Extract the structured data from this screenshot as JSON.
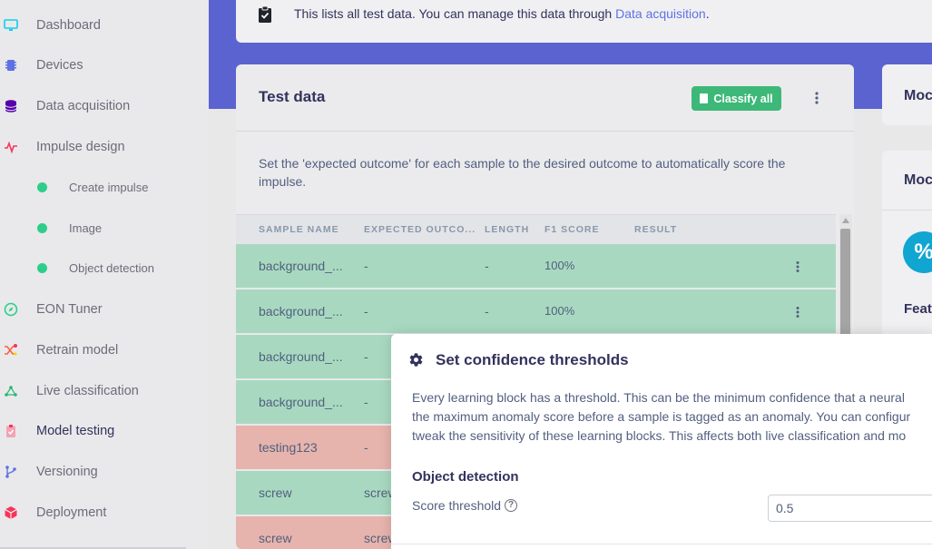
{
  "sidebar": {
    "items": [
      {
        "label": "Dashboard",
        "icon": "monitor-icon"
      },
      {
        "label": "Devices",
        "icon": "chip-icon"
      },
      {
        "label": "Data acquisition",
        "icon": "database-icon"
      },
      {
        "label": "Impulse design",
        "icon": "pulse-icon"
      },
      {
        "label": "Create impulse",
        "icon": "dot-icon"
      },
      {
        "label": "Image",
        "icon": "dot-icon"
      },
      {
        "label": "Object detection",
        "icon": "dot-icon"
      },
      {
        "label": "EON Tuner",
        "icon": "compass-icon"
      },
      {
        "label": "Retrain model",
        "icon": "shuffle-icon"
      },
      {
        "label": "Live classification",
        "icon": "network-icon"
      },
      {
        "label": "Model testing",
        "icon": "clipboard-check-icon"
      },
      {
        "label": "Versioning",
        "icon": "branch-icon"
      },
      {
        "label": "Deployment",
        "icon": "cube-icon"
      }
    ]
  },
  "info": {
    "text": "This lists all test data. You can manage this data through ",
    "link": "Data acquisition",
    "suffix": "."
  },
  "test_data": {
    "title": "Test data",
    "classify_all": "Classify all",
    "description": "Set the 'expected outcome' for each sample to the desired outcome to automatically score the impulse.",
    "columns": [
      "SAMPLE NAME",
      "EXPECTED OUTCO...",
      "LENGTH",
      "F1 SCORE",
      "RESULT"
    ],
    "rows": [
      {
        "name": "background_...",
        "expected": "-",
        "length": "-",
        "f1": "100%",
        "status": "pass"
      },
      {
        "name": "background_...",
        "expected": "-",
        "length": "-",
        "f1": "100%",
        "status": "pass"
      },
      {
        "name": "background_...",
        "expected": "-",
        "length": "",
        "f1": "",
        "status": "pass"
      },
      {
        "name": "background_...",
        "expected": "-",
        "length": "",
        "f1": "",
        "status": "pass"
      },
      {
        "name": "testing123",
        "expected": "-",
        "length": "",
        "f1": "",
        "status": "fail"
      },
      {
        "name": "screw",
        "expected": "screw",
        "length": "",
        "f1": "",
        "status": "pass"
      },
      {
        "name": "screw",
        "expected": "screw",
        "length": "",
        "f1": "",
        "status": "fail"
      }
    ]
  },
  "right_cards": {
    "card1_title": "Moc",
    "card2_title": "Moc",
    "card2_feat": "Feat",
    "card2_icon": "%"
  },
  "modal": {
    "title": "Set confidence thresholds",
    "desc_line1": "Every learning block has a threshold. This can be the minimum confidence that a neural",
    "desc_line2": "the maximum anomaly score before a sample is tagged as an anomaly. You can configur",
    "desc_line3": "tweak the sensitivity of these learning blocks. This affects both live classification and mo",
    "section": "Object detection",
    "score_label": "Score threshold",
    "score_value": "0.5"
  },
  "colors": {
    "accent": "#5a63cf",
    "pass": "#a8d9c0",
    "fail": "#e6b4ac",
    "button": "#3db878"
  }
}
